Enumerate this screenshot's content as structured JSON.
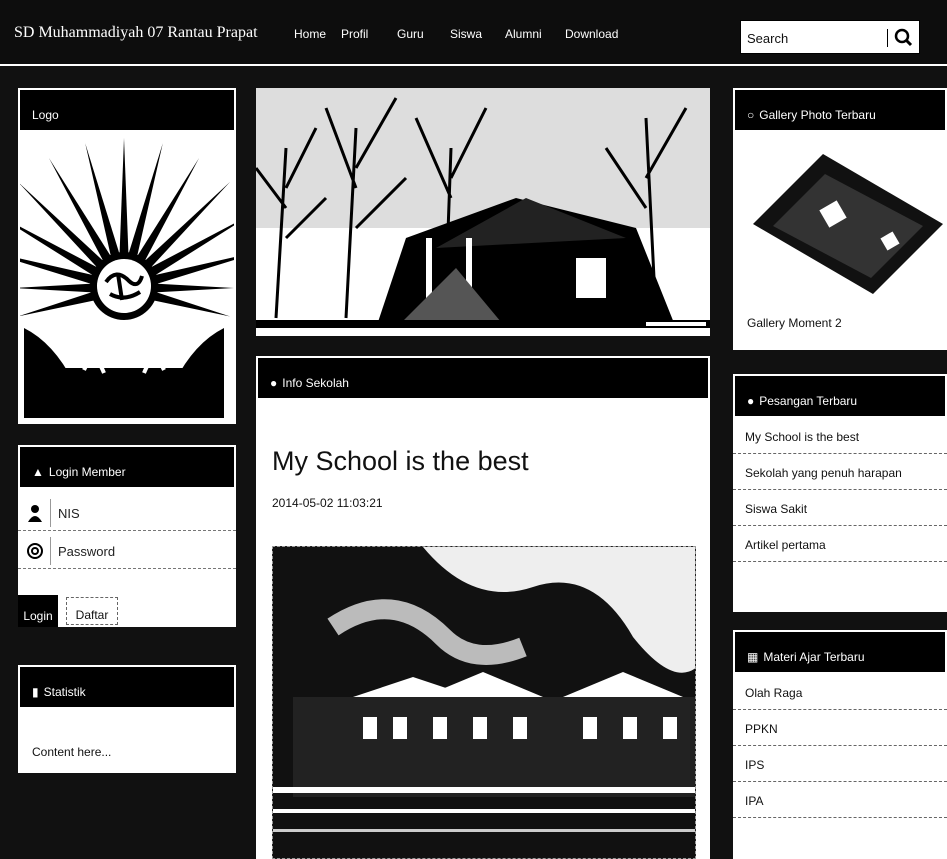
{
  "brand": "SD Muhammadiyah 07 Rantau Prapat",
  "nav": [
    "Home",
    "Profil",
    "Guru",
    "Siswa",
    "Alumni",
    "Download"
  ],
  "search": {
    "placeholder": "Search"
  },
  "logo_panel": {
    "title": "Logo"
  },
  "login_panel": {
    "title": "Login Member",
    "nis_placeholder": "NIS",
    "password_placeholder": "Password",
    "login_label": "Login",
    "daftar_label": "Daftar"
  },
  "stat_panel": {
    "title": "Statistik",
    "content": "Content here..."
  },
  "info_panel": {
    "title": "Info Sekolah",
    "post_title": "My School is the best",
    "post_date": "2014-05-02 11:03:21"
  },
  "gallery_panel": {
    "title": "Gallery Photo Terbaru",
    "caption": "Gallery Moment 2"
  },
  "pesan_panel": {
    "title": "Pesangan Terbaru",
    "items": [
      "My School is the best",
      "Sekolah yang penuh harapan",
      "Siswa Sakit",
      "Artikel pertama"
    ]
  },
  "mater_panel": {
    "title": "Materi Ajar Terbaru",
    "items": [
      "Olah Raga",
      "PPKN",
      "IPS",
      "IPA"
    ]
  },
  "colors": {
    "navbar": "#0d0d0d",
    "panel_header": "#000000",
    "background": "#111111"
  }
}
